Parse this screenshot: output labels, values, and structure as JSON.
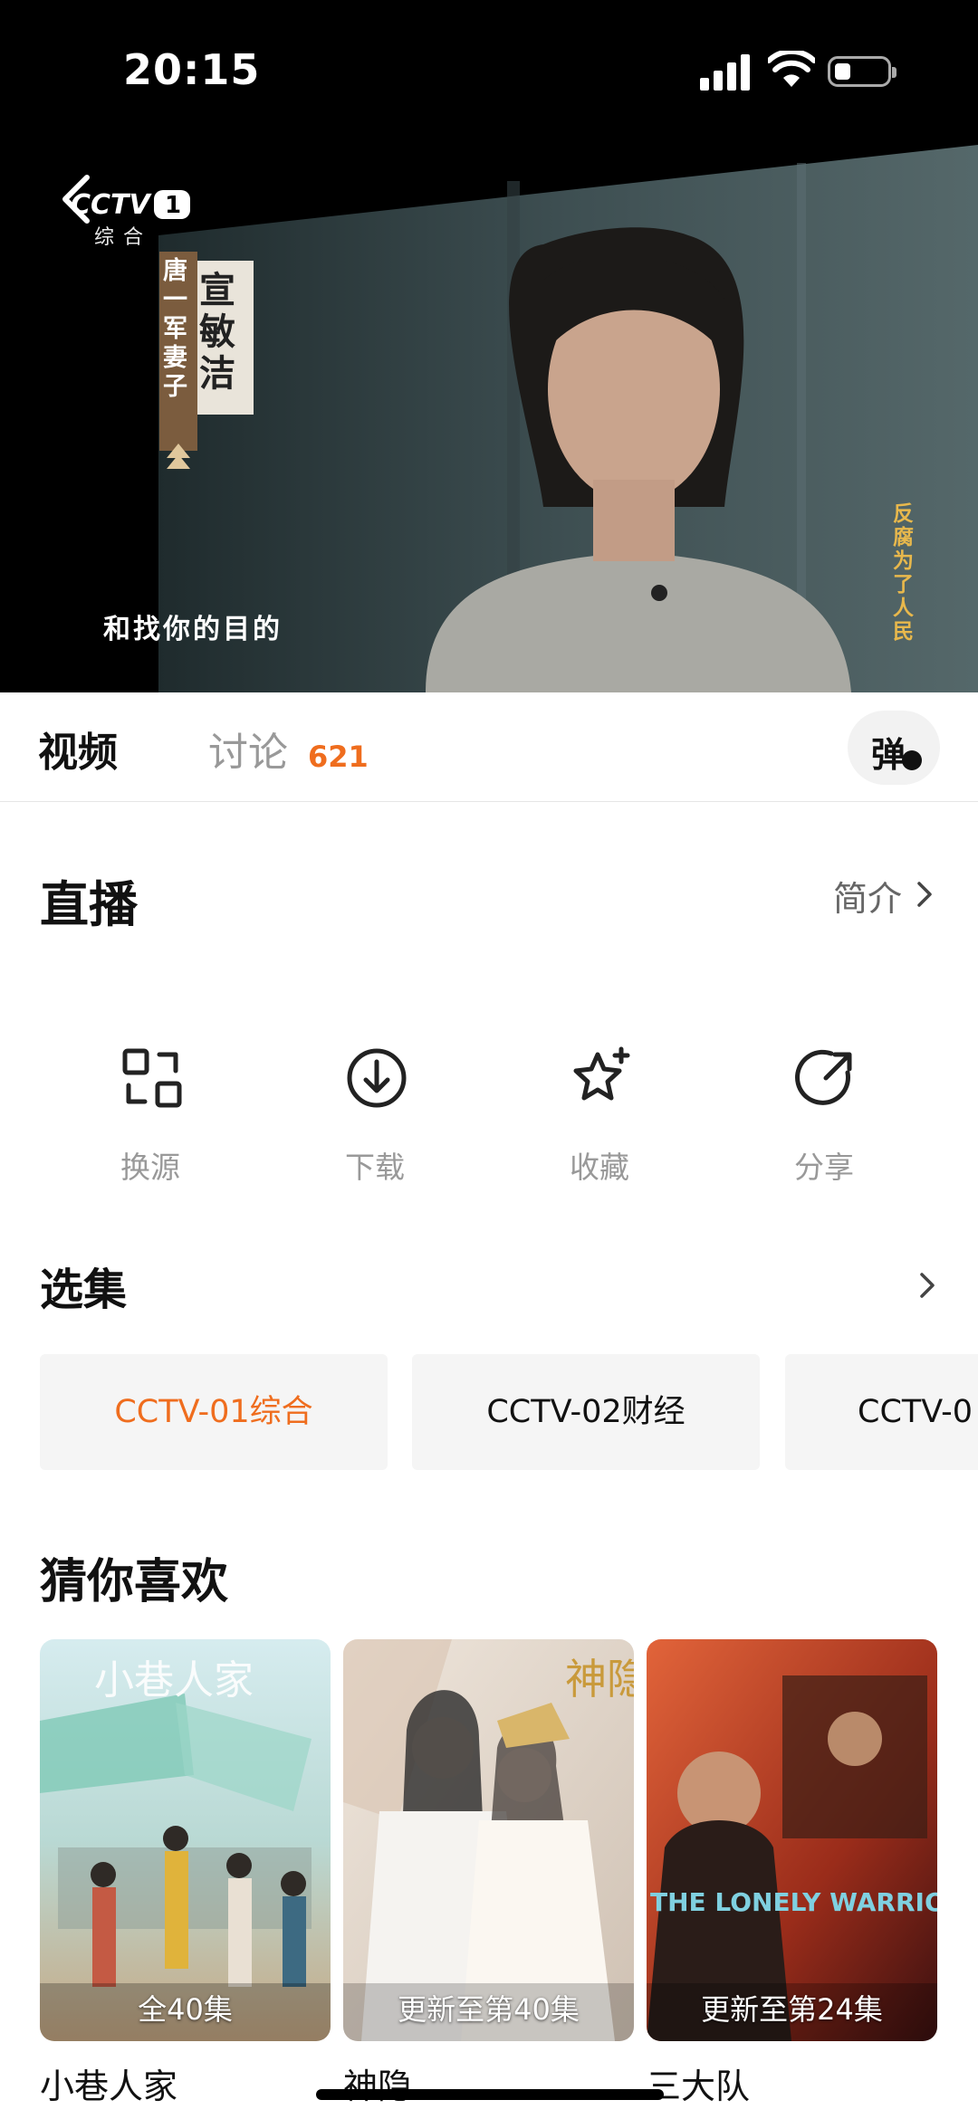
{
  "status_bar": {
    "time": "20:15"
  },
  "video": {
    "channel_logo": "CCTV 1",
    "channel_sub": "综合",
    "person_name": "宣敏洁",
    "person_role": "唐一军妻子",
    "subtitle": "和找你的目的",
    "watermark": "反腐为了人民"
  },
  "tabs": {
    "video_label": "视频",
    "discuss_label": "讨论",
    "discuss_count": "621",
    "danmaku_label": "弹"
  },
  "live": {
    "title": "直播",
    "intro_label": "简介"
  },
  "actions": [
    {
      "label": "换源",
      "icon": "switch-source-icon"
    },
    {
      "label": "下载",
      "icon": "download-icon"
    },
    {
      "label": "收藏",
      "icon": "star-add-icon"
    },
    {
      "label": "分享",
      "icon": "share-icon"
    }
  ],
  "episodes": {
    "title": "选集",
    "items": [
      "CCTV-01综合",
      "CCTV-02财经",
      "CCTV-0"
    ]
  },
  "recommend": {
    "title": "猜你喜欢",
    "items": [
      {
        "name": "小巷人家",
        "badge": "全40集",
        "poster_text": "小巷人家"
      },
      {
        "name": "神隐",
        "badge": "更新至第40集",
        "poster_text": "神隐"
      },
      {
        "name": "三大队",
        "badge": "更新至第24集",
        "poster_text": "THE LONELY WARRIOR"
      }
    ]
  },
  "colors": {
    "accent": "#ef6d1e",
    "muted": "#999999"
  }
}
